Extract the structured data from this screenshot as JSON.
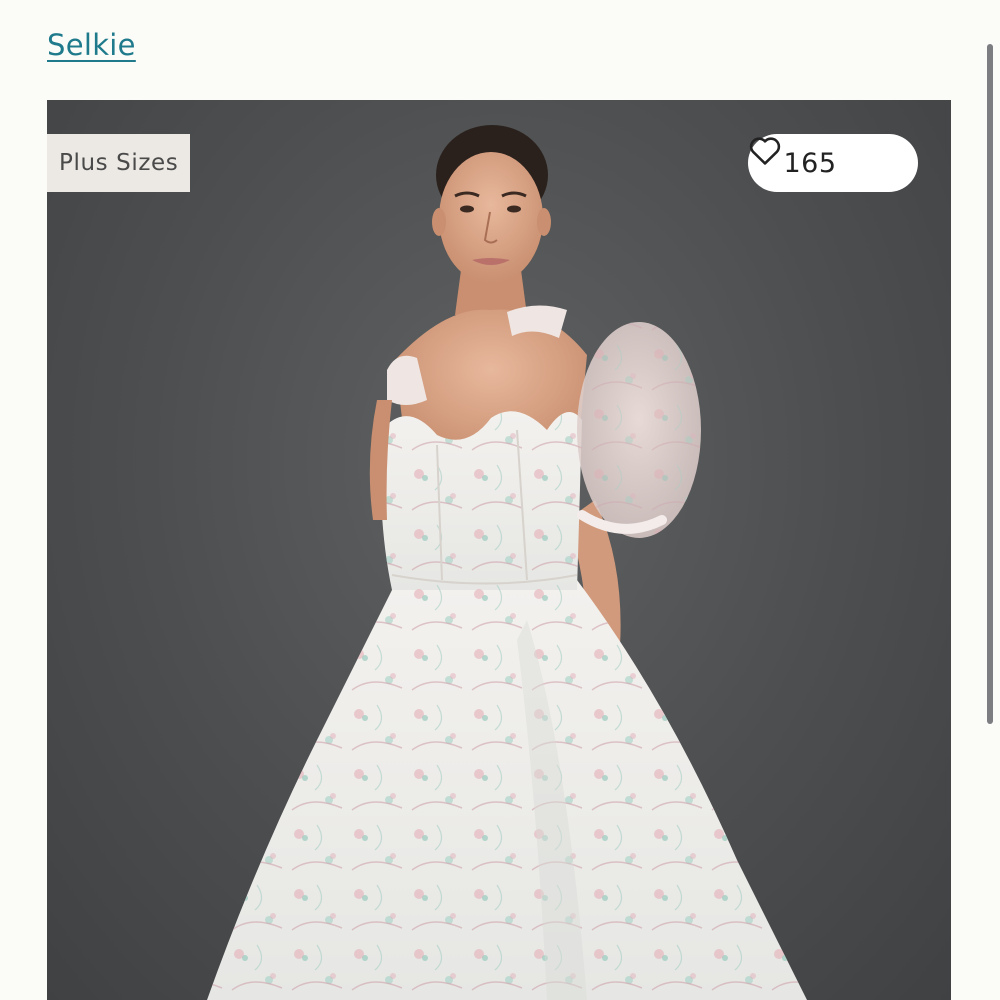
{
  "header": {
    "brand_link": "Selkie"
  },
  "product": {
    "badge": "Plus Sizes",
    "likes": "165",
    "like_icon": "heart-outline-icon",
    "image_subject": "model-in-floral-puff-sleeve-dress"
  },
  "colors": {
    "link": "#1f7a8c",
    "background": "#fbfcf8",
    "photo_backdrop": "#4c4e50",
    "badge_bg": "#ece8e3"
  }
}
